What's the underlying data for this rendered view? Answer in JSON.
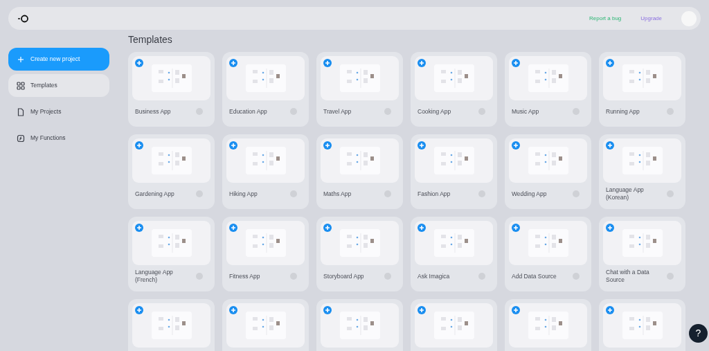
{
  "header": {
    "links": [
      {
        "label": "Report a bug",
        "kind": "report"
      },
      {
        "label": "Upgrade",
        "kind": "upgrade"
      }
    ]
  },
  "sidebar": {
    "items": [
      {
        "label": "Create new project",
        "kind": "primary",
        "selected": false
      },
      {
        "label": "Templates",
        "kind": "nav",
        "selected": true
      },
      {
        "label": "My Projects",
        "kind": "nav",
        "selected": false
      },
      {
        "label": "My Functions",
        "kind": "nav",
        "selected": false
      }
    ]
  },
  "main": {
    "title": "Templates",
    "templates": [
      {
        "kind": "titled",
        "title": "Business App"
      },
      {
        "kind": "titled",
        "title": "Education App"
      },
      {
        "kind": "titled",
        "title": "Travel App"
      },
      {
        "kind": "titled",
        "title": "Cooking App"
      },
      {
        "kind": "titled",
        "title": "Music App"
      },
      {
        "kind": "titled",
        "title": "Running App"
      },
      {
        "kind": "titled",
        "title": "Gardening App"
      },
      {
        "kind": "titled",
        "title": "Hiking App"
      },
      {
        "kind": "titled",
        "title": "Maths App"
      },
      {
        "kind": "titled",
        "title": "Fashion App"
      },
      {
        "kind": "titled",
        "title": "Wedding App"
      },
      {
        "kind": "titled",
        "title": "Language App (Korean)"
      },
      {
        "kind": "titled",
        "title": "Language App (French)"
      },
      {
        "kind": "titled",
        "title": "Fitness App"
      },
      {
        "kind": "titled",
        "title": "Storyboard App"
      },
      {
        "kind": "titled",
        "title": "Ask Imagica"
      },
      {
        "kind": "titled",
        "title": "Add Data Source"
      },
      {
        "kind": "titled",
        "title": "Chat with a Data Source"
      },
      {
        "kind": "cut"
      },
      {
        "kind": "cut"
      },
      {
        "kind": "cut"
      },
      {
        "kind": "cut"
      },
      {
        "kind": "cut"
      },
      {
        "kind": "cut"
      }
    ]
  },
  "help_button": {
    "label": "?"
  }
}
